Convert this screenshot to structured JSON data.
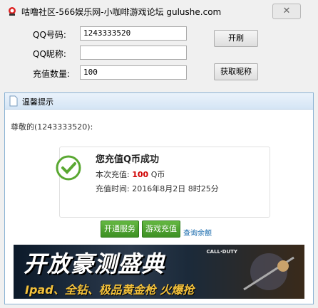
{
  "window": {
    "title": "咕噜社区-566娱乐网-小咖啡游戏论坛 gulushe.com",
    "close_label": "✕"
  },
  "form": {
    "qq_label": "QQ号码:",
    "qq_value": "1243333520",
    "nick_label": "QQ昵称:",
    "nick_value": "",
    "amount_label": "充值数量:",
    "amount_value": "100",
    "refresh_label": "开刷",
    "get_nick_label": "获取昵称"
  },
  "dialog": {
    "title": "温馨提示",
    "greeting": "尊敬的(1243333520):",
    "success": "您充值Q币成功",
    "amount_prefix": "本次充值:",
    "amount_value": "100",
    "amount_unit": "Q币",
    "time_prefix": "充值时间:",
    "time_value": "2016年8月2日 8时25分",
    "btn_open_service": "开通服务",
    "btn_game_recharge": "游戏充值",
    "link_query_balance": "查询余额"
  },
  "banner": {
    "headline": "开放豪测盛典",
    "subline": "Ipad、全钻、极品黄金枪 火爆抢",
    "logo": "CALL·DUTY"
  },
  "colors": {
    "accent_green": "#3d8f23",
    "highlight_red": "#d00000",
    "dialog_border": "#8ab2d4"
  }
}
